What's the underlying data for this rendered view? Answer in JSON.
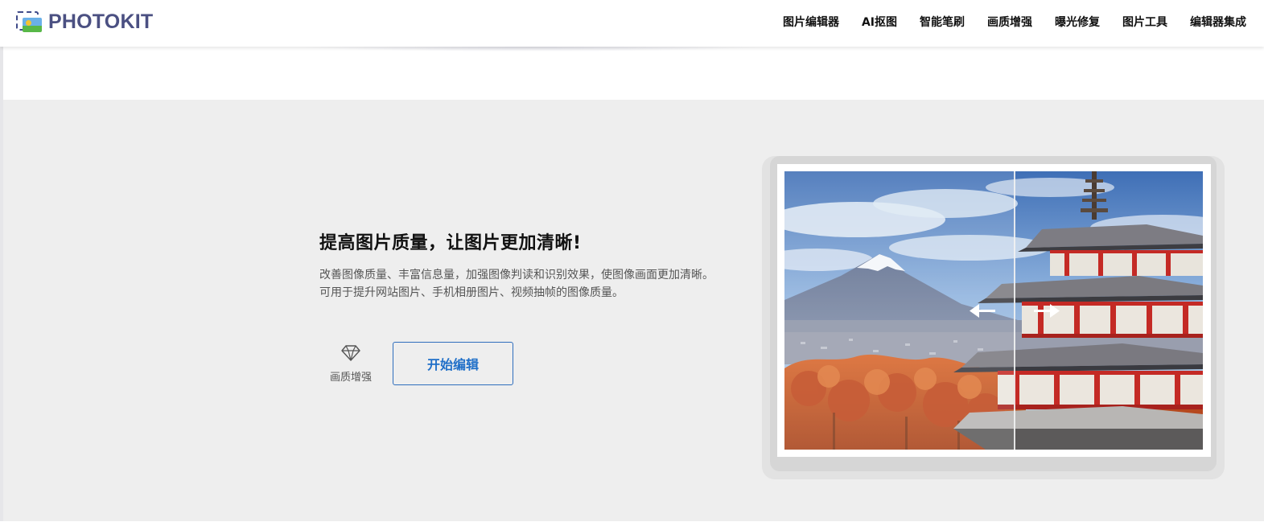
{
  "header": {
    "logo_text": "PHOTOKIT",
    "logo_icon": "image-frame-icon",
    "nav": [
      {
        "label": "图片编辑器"
      },
      {
        "label": "AI抠图"
      },
      {
        "label": "智能笔刷"
      },
      {
        "label": "画质增强"
      },
      {
        "label": "曝光修复"
      },
      {
        "label": "图片工具"
      },
      {
        "label": "编辑器集成"
      }
    ]
  },
  "feature": {
    "title": "提高图片质量，让图片更加清晰!",
    "description_lines": [
      "改善图像质量、丰富信息量，加强图像判读和识别效果，使图像画面更加清晰。",
      "可用于提升网站图片、手机相册图片、视频抽帧的图像质量。"
    ],
    "badge_label": "画质增强",
    "badge_icon": "diamond-icon",
    "cta_label": "开始编辑"
  },
  "demo": {
    "handle_icons": [
      "arrow-left-icon",
      "arrow-right-icon"
    ],
    "slider_position": 0.55
  },
  "colors": {
    "brand": "#4b5082",
    "accent": "#1f6fc8",
    "section_bg": "#eeeeee"
  }
}
